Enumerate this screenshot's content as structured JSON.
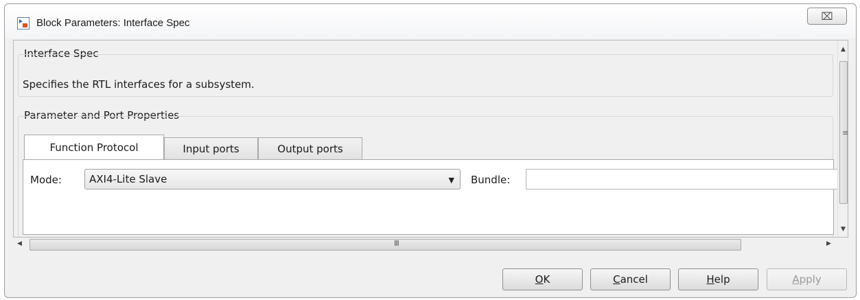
{
  "window": {
    "title": "Block Parameters: Interface Spec",
    "close_glyph": "⌧"
  },
  "interface_spec": {
    "group_label": "Interface Spec",
    "description": "Specifies the RTL interfaces for a subsystem."
  },
  "params": {
    "group_label": "Parameter and Port Properties",
    "tabs": [
      {
        "label": "Function Protocol",
        "active": true
      },
      {
        "label": "Input ports",
        "active": false
      },
      {
        "label": "Output ports",
        "active": false
      }
    ],
    "mode_label": "Mode:",
    "mode_value": "AXI4-Lite Slave",
    "bundle_label": "Bundle:",
    "bundle_value": ""
  },
  "scrollbars": {
    "h_grip": "III",
    "v_grip": "≡"
  },
  "buttons": {
    "ok": {
      "mnemonic": "O",
      "rest": "K"
    },
    "cancel": {
      "mnemonic": "C",
      "rest": "ancel"
    },
    "help": {
      "mnemonic": "H",
      "rest": "elp"
    },
    "apply": {
      "mnemonic": "A",
      "rest": "pply",
      "disabled": true
    }
  },
  "icons": {
    "app": "simulink-block-icon",
    "dropdown": "chevron-down-icon"
  }
}
